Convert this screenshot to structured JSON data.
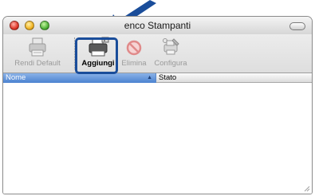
{
  "window": {
    "title": "enco Stampanti"
  },
  "toolbar": {
    "items": [
      {
        "label": "Rendi Default",
        "icon": "default-printer-icon",
        "enabled": false
      },
      {
        "label": "Aggiungi",
        "icon": "printer-add-icon",
        "enabled": true
      },
      {
        "label": "Elimina",
        "icon": "delete-icon",
        "enabled": false
      },
      {
        "label": "Configura",
        "icon": "configure-icon",
        "enabled": false
      }
    ]
  },
  "table": {
    "columns": [
      {
        "label": "Nome",
        "sorted": true
      },
      {
        "label": "Stato",
        "sorted": false
      }
    ],
    "rows": []
  },
  "colors": {
    "highlight_ring": "#1a4d9a",
    "arrow": "#1a4d9a",
    "selected_column": "#4b82d0"
  }
}
